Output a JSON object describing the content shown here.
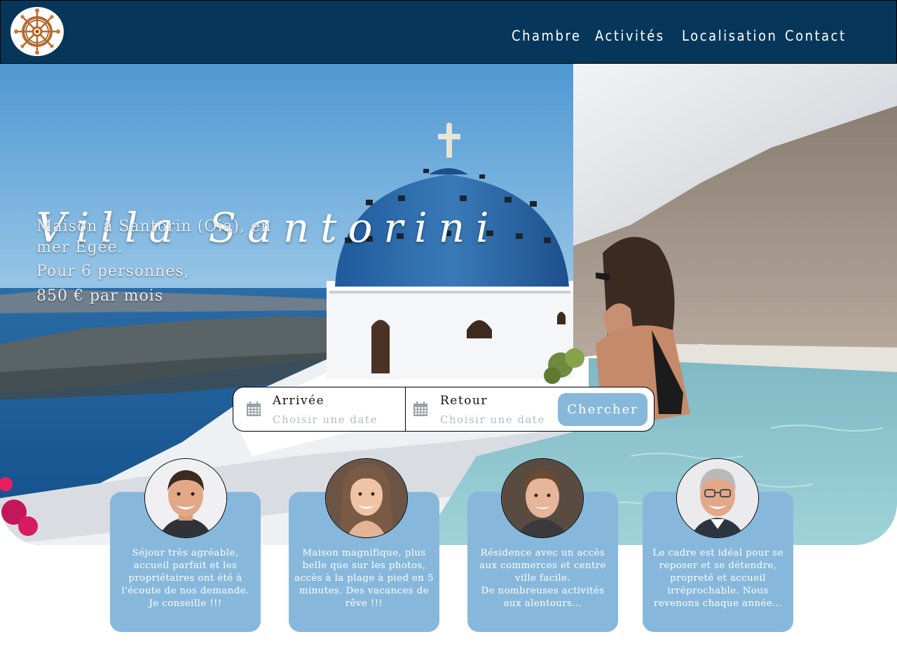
{
  "header": {
    "logo_icon": "ship-wheel-icon",
    "nav": [
      "Chambre",
      "Activités",
      "Localisation",
      "Contact"
    ]
  },
  "hero": {
    "title": "Villa Santorini",
    "line1": "Maison à Santorin (Oia), en mer Egée.",
    "line2": "Pour 6 personnes,",
    "line3": "850 € par mois"
  },
  "search": {
    "arrival_label": "Arrivée",
    "arrival_placeholder": "Choisir une date",
    "return_label": "Retour",
    "return_placeholder": "Choisir une date",
    "button": "Chercher",
    "calendar_icon": "calendar-icon"
  },
  "testimonials": [
    {
      "text": "Séjour très agréable, accueil parfait et les propriétaires ont été à l'écoute de nos demande.\nJe conseille !!!"
    },
    {
      "text": "Maison magnifique, plus belle que sur les photos, accès à la plage à pied en 5 minutes. Des vacances de rêve !!!"
    },
    {
      "text": "Résidence avec un accès aux commerces et centre ville facile.\nDe nombreuses activités aux alentours..."
    },
    {
      "text": "Le cadre est idéal pour se reposer et se détendre, propreté et accueil irréprochable. Nous revenons chaque année..."
    }
  ],
  "colors": {
    "header_bg": "#06375a",
    "accent": "#87b8dc"
  }
}
